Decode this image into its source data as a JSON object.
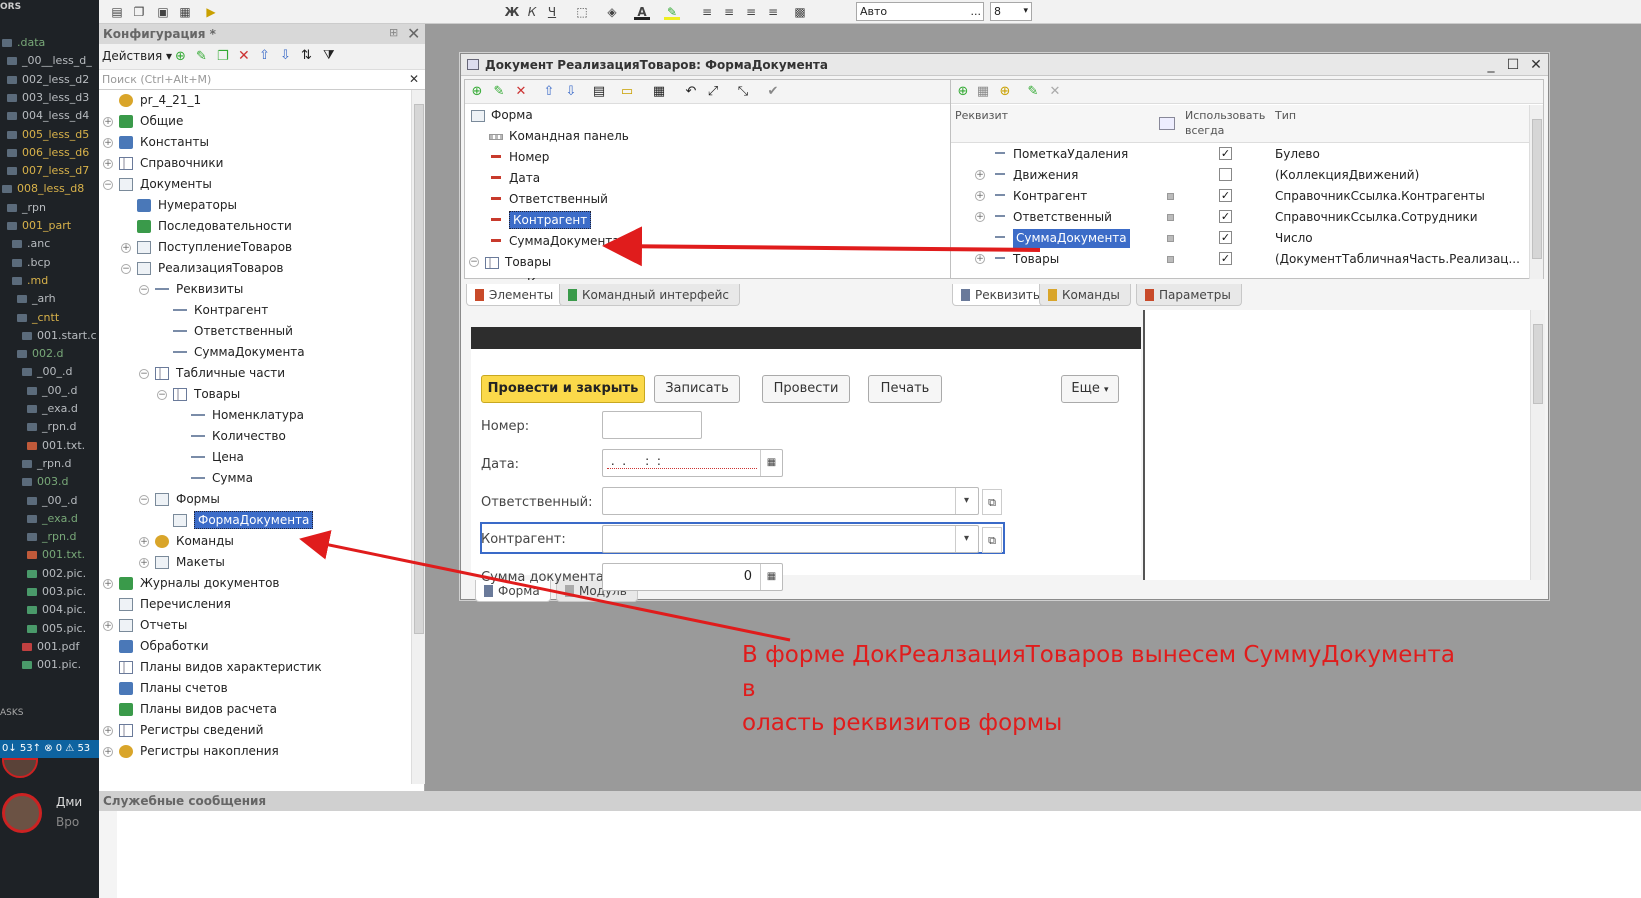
{
  "explorer": {
    "header": "ORS",
    "items": [
      {
        "label": ".data",
        "color": "green"
      },
      {
        "label": "_00__less_d_",
        "color": "white"
      },
      {
        "label": "002_less_d2",
        "color": "white"
      },
      {
        "label": "003_less_d3",
        "color": "white"
      },
      {
        "label": "004_less_d4",
        "color": "white"
      },
      {
        "label": "005_less_d5",
        "color": "yellow"
      },
      {
        "label": "006_less_d6",
        "color": "yellow"
      },
      {
        "label": "007_less_d7",
        "color": "yellow"
      },
      {
        "label": "008_less_d8",
        "color": "yellow"
      },
      {
        "label": "_rpn",
        "color": "white"
      },
      {
        "label": "001_part",
        "color": "yellow"
      },
      {
        "label": ".anc",
        "color": "white"
      },
      {
        "label": ".bcp",
        "color": "white"
      },
      {
        "label": ".md",
        "color": "yellow"
      },
      {
        "label": "_arh",
        "color": "white"
      },
      {
        "label": "_cntt",
        "color": "yellow"
      },
      {
        "label": "001.start.c",
        "color": "white"
      },
      {
        "label": "002.d",
        "color": "green"
      },
      {
        "label": "_00_.d",
        "color": "white"
      },
      {
        "label": "_00_.d",
        "color": "white"
      },
      {
        "label": "_exa.d",
        "color": "white"
      },
      {
        "label": "_rpn.d",
        "color": "white"
      },
      {
        "label": "001.txt.",
        "color": "white"
      },
      {
        "label": "_rpn.d",
        "color": "white"
      },
      {
        "label": "003.d",
        "color": "green"
      },
      {
        "label": "_00_.d",
        "color": "white"
      },
      {
        "label": "_exa.d",
        "color": "green"
      },
      {
        "label": "_rpn.d",
        "color": "green"
      },
      {
        "label": "001.txt.",
        "color": "green"
      },
      {
        "label": "002.pic.",
        "color": "white"
      },
      {
        "label": "003.pic.",
        "color": "white"
      },
      {
        "label": "004.pic.",
        "color": "white"
      },
      {
        "label": "005.pic.",
        "color": "white"
      },
      {
        "label": "001.pdf",
        "color": "white"
      },
      {
        "label": "001.pic.",
        "color": "white"
      }
    ],
    "tasks_label": "ASKS",
    "status_text": "0↓ 53↑ ⊗ 0 ⚠ 53",
    "user_name": "Дми",
    "user_sub": "Вро"
  },
  "toolbar": {
    "bold": "Ж",
    "italic": "К",
    "underline": "Ч",
    "font_color": "A",
    "font_name": "Авто",
    "font_size": "8",
    "more": "..."
  },
  "config": {
    "title": "Конфигурация *",
    "actions_label": "Действия ▾",
    "search_placeholder": "Поиск (Ctrl+Alt+M)",
    "tree": [
      {
        "label": "pr_4_21_1",
        "level": 0,
        "exp": "",
        "icon": "gold"
      },
      {
        "label": "Общие",
        "level": 0,
        "exp": "+",
        "icon": "grn"
      },
      {
        "label": "Константы",
        "level": 0,
        "exp": "+",
        "icon": "blue"
      },
      {
        "label": "Справочники",
        "level": 0,
        "exp": "+",
        "icon": "tab"
      },
      {
        "label": "Документы",
        "level": 0,
        "exp": "−",
        "icon": "doc"
      },
      {
        "label": "Нумераторы",
        "level": 1,
        "exp": "",
        "icon": "blue"
      },
      {
        "label": "Последовательности",
        "level": 1,
        "exp": "",
        "icon": "grn"
      },
      {
        "label": "ПоступлениеТоваров",
        "level": 1,
        "exp": "+",
        "icon": "doc"
      },
      {
        "label": "РеализацияТоваров",
        "level": 1,
        "exp": "−",
        "icon": "doc"
      },
      {
        "label": "Реквизиты",
        "level": 2,
        "exp": "−",
        "icon": "attr"
      },
      {
        "label": "Контрагент",
        "level": 3,
        "exp": "",
        "icon": "attr"
      },
      {
        "label": "Ответственный",
        "level": 3,
        "exp": "",
        "icon": "attr"
      },
      {
        "label": "СуммаДокумента",
        "level": 3,
        "exp": "",
        "icon": "attr"
      },
      {
        "label": "Табличные части",
        "level": 2,
        "exp": "−",
        "icon": "tab"
      },
      {
        "label": "Товары",
        "level": 3,
        "exp": "−",
        "icon": "tab"
      },
      {
        "label": "Номенклатура",
        "level": 4,
        "exp": "",
        "icon": "attr"
      },
      {
        "label": "Количество",
        "level": 4,
        "exp": "",
        "icon": "attr"
      },
      {
        "label": "Цена",
        "level": 4,
        "exp": "",
        "icon": "attr"
      },
      {
        "label": "Сумма",
        "level": 4,
        "exp": "",
        "icon": "attr"
      },
      {
        "label": "Формы",
        "level": 2,
        "exp": "−",
        "icon": "doc"
      },
      {
        "label": "ФормаДокумента",
        "level": 3,
        "exp": "",
        "icon": "doc",
        "selected": true
      },
      {
        "label": "Команды",
        "level": 2,
        "exp": "+",
        "icon": "gold"
      },
      {
        "label": "Макеты",
        "level": 2,
        "exp": "+",
        "icon": "doc"
      },
      {
        "label": "Журналы документов",
        "level": 0,
        "exp": "+",
        "icon": "grn"
      },
      {
        "label": "Перечисления",
        "level": 0,
        "exp": "",
        "icon": "doc"
      },
      {
        "label": "Отчеты",
        "level": 0,
        "exp": "+",
        "icon": "doc"
      },
      {
        "label": "Обработки",
        "level": 0,
        "exp": "",
        "icon": "blue"
      },
      {
        "label": "Планы видов характеристик",
        "level": 0,
        "exp": "",
        "icon": "tab"
      },
      {
        "label": "Планы счетов",
        "level": 0,
        "exp": "",
        "icon": "blue"
      },
      {
        "label": "Планы видов расчета",
        "level": 0,
        "exp": "",
        "icon": "grn"
      },
      {
        "label": "Регистры сведений",
        "level": 0,
        "exp": "+",
        "icon": "tab"
      },
      {
        "label": "Регистры накопления",
        "level": 0,
        "exp": "+",
        "icon": "gold"
      }
    ]
  },
  "messages": {
    "title": "Служебные сообщения"
  },
  "form_window": {
    "title": "Документ РеализацияТоваров: ФормаДокумента",
    "elements": [
      {
        "label": "Форма",
        "level": 0,
        "icon": "doc"
      },
      {
        "label": "Командная панель",
        "level": 1,
        "icon": "cmd"
      },
      {
        "label": "Номер",
        "level": 1,
        "icon": "red"
      },
      {
        "label": "Дата",
        "level": 1,
        "icon": "red"
      },
      {
        "label": "Ответственный",
        "level": 1,
        "icon": "red"
      },
      {
        "label": "Контрагент",
        "level": 1,
        "icon": "red",
        "selected": true
      },
      {
        "label": "СуммаДокумента",
        "level": 1,
        "icon": "red"
      },
      {
        "label": "Товары",
        "level": 0,
        "icon": "tab",
        "exp": "−"
      },
      {
        "label": "Командная панель",
        "level": 2,
        "icon": "cmd"
      }
    ],
    "left_tabs": [
      "Элементы",
      "Командный интерфейс"
    ],
    "attr_headers": {
      "name": "Реквизит",
      "use": "Использовать всегда",
      "type": "Тип"
    },
    "attributes": [
      {
        "name": "ПометкаУдаления",
        "exp": "",
        "sq": false,
        "checked": true,
        "type": "Булево"
      },
      {
        "name": "Движения",
        "exp": "+",
        "sq": false,
        "checked": false,
        "type": "(КоллекцияДвижений)"
      },
      {
        "name": "Контрагент",
        "exp": "+",
        "sq": true,
        "checked": true,
        "type": "СправочникСсылка.Контрагенты"
      },
      {
        "name": "Ответственный",
        "exp": "+",
        "sq": true,
        "checked": true,
        "type": "СправочникСсылка.Сотрудники"
      },
      {
        "name": "СуммаДокумента",
        "exp": "",
        "sq": true,
        "checked": true,
        "type": "Число",
        "selected": true
      },
      {
        "name": "Товары",
        "exp": "+",
        "sq": true,
        "checked": true,
        "type": "(ДокументТабличнаяЧасть.Реализац..."
      }
    ],
    "right_tabs": [
      "Реквизиты",
      "Команды",
      "Параметры"
    ],
    "bottom_tabs": [
      "Форма",
      "Модуль"
    ]
  },
  "preview": {
    "buttons": [
      "Провести и закрыть",
      "Записать",
      "Провести",
      "Печать",
      "Еще"
    ],
    "fields": [
      {
        "label": "Номер:",
        "value": ""
      },
      {
        "label": "Дата:",
        "value": " .  .     :  :  "
      },
      {
        "label": "Ответственный:",
        "value": ""
      },
      {
        "label": "Контрагент:",
        "value": ""
      },
      {
        "label": "Сумма документа:",
        "value": "0"
      }
    ]
  },
  "annotation": {
    "text_line1": "В форме ДокРеалзацияТоваров вынесем СуммуДокумента в",
    "text_line2": "оласть реквизитов формы",
    "color": "#e01c1c"
  }
}
